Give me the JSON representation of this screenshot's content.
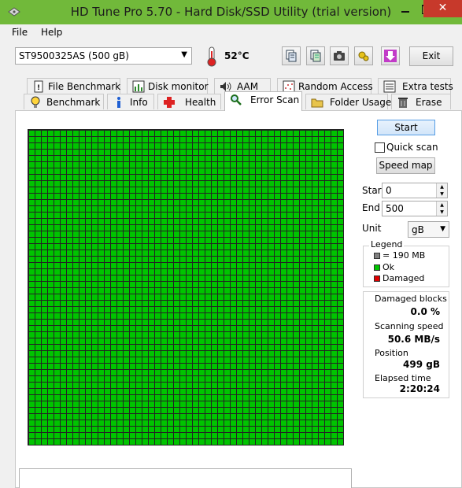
{
  "window": {
    "title": "HD Tune Pro 5.70 - Hard Disk/SSD Utility (trial version)",
    "close_symbol": "✕"
  },
  "menu": {
    "file": "File",
    "help": "Help"
  },
  "toolbar": {
    "drive": "ST9500325AS (500 gB)",
    "temperature": "52°C",
    "exit_label": "Exit"
  },
  "tabs_top": [
    {
      "label": "File Benchmark"
    },
    {
      "label": "Disk monitor"
    },
    {
      "label": "AAM"
    },
    {
      "label": "Random Access"
    },
    {
      "label": "Extra tests"
    }
  ],
  "tabs_bottom": [
    {
      "label": "Benchmark"
    },
    {
      "label": "Info"
    },
    {
      "label": "Health"
    },
    {
      "label": "Error Scan"
    },
    {
      "label": "Folder Usage"
    },
    {
      "label": "Erase"
    }
  ],
  "controls": {
    "start_label": "Start",
    "quick_scan_label": "Quick scan",
    "speed_map_label": "Speed map",
    "start_field_label": "Start",
    "start_value": "0",
    "end_field_label": "End",
    "end_value": "500",
    "unit_label": "Unit",
    "unit_value": "gB"
  },
  "legend": {
    "title": "Legend",
    "items": [
      {
        "label": "= 190 MB",
        "color": "#808080"
      },
      {
        "label": "Ok",
        "color": "#00c400"
      },
      {
        "label": "Damaged",
        "color": "#e00000"
      }
    ]
  },
  "stats": {
    "damaged_blocks_label": "Damaged blocks",
    "damaged_blocks_value": "0.0 %",
    "scanning_speed_label": "Scanning speed",
    "scanning_speed_value": "50.6 MB/s",
    "position_label": "Position",
    "position_value": "499 gB",
    "elapsed_label": "Elapsed time",
    "elapsed_value": "2:20:24"
  },
  "scan_map": {
    "block_state": "ok",
    "color": "#00c400"
  }
}
